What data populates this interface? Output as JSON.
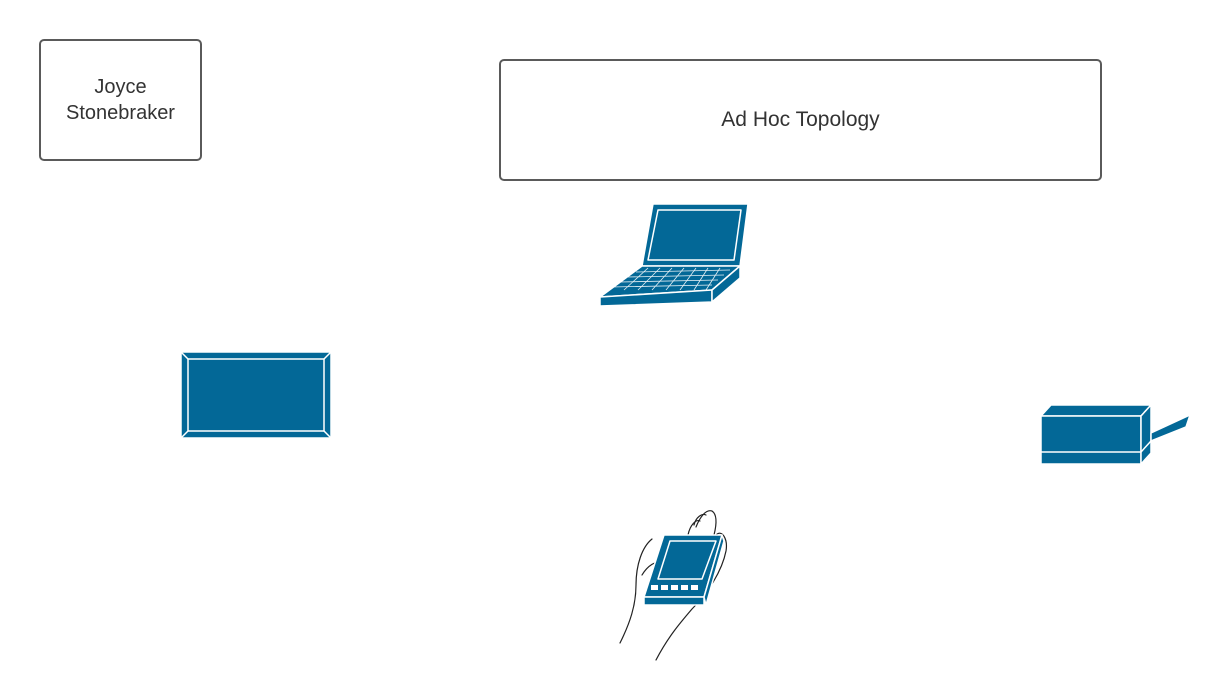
{
  "author_label": "Joyce\nStonebraker",
  "title_label": "Ad Hoc Topology",
  "icons": {
    "laptop": "laptop-icon",
    "monitor": "flat-panel-display-icon",
    "pda": "handheld-pda-icon",
    "access_point": "wireless-device-icon"
  },
  "colors": {
    "device_fill": "#036897",
    "device_stroke": "#ffffff",
    "box_border": "#5a5a5a",
    "text": "#333333"
  }
}
